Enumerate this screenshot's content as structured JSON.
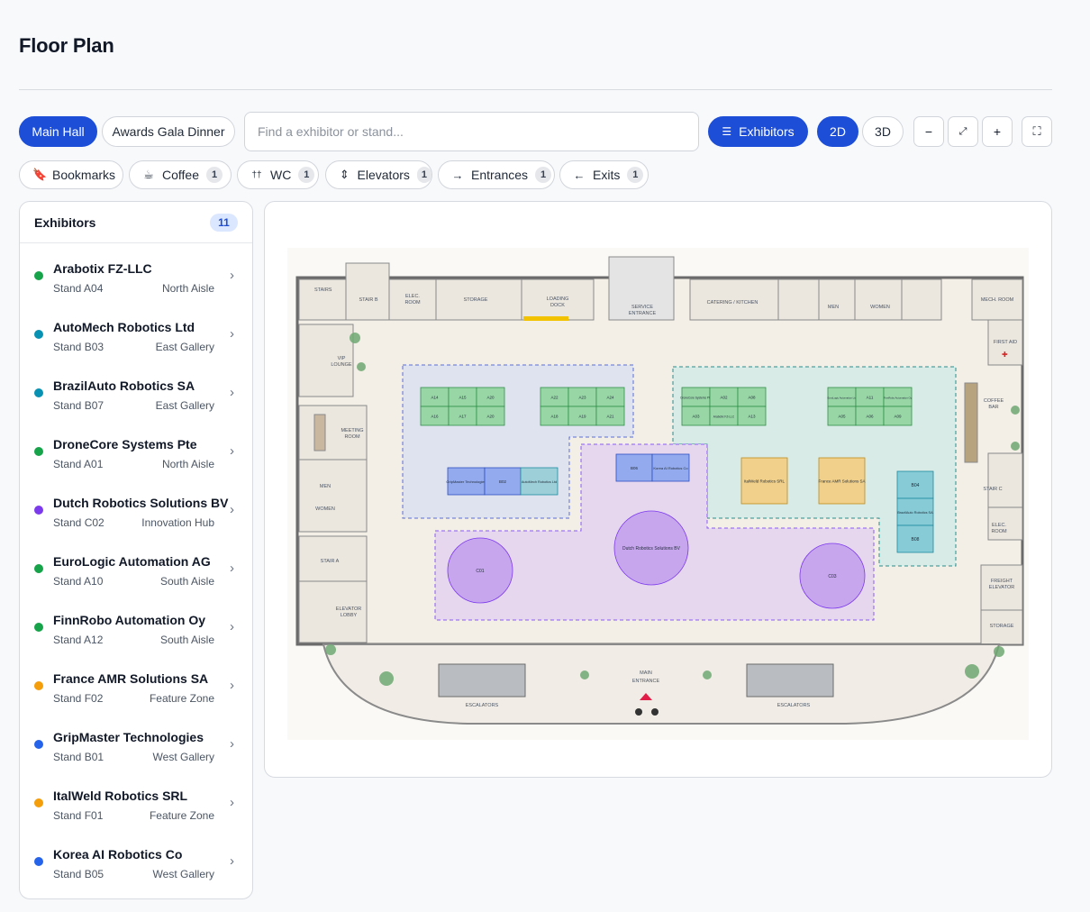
{
  "page": {
    "title": "Floor Plan"
  },
  "toolbar": {
    "tabs": [
      {
        "label": "Main Hall"
      },
      {
        "label": "Awards Gala Dinner"
      }
    ],
    "search_placeholder": "Find a exhibitor or stand...",
    "exhibitors_label": "Exhibitors",
    "view_2d": "2D",
    "view_3d": "3D",
    "zoom_out": "−",
    "zoom_reset": "⤢",
    "zoom_in": "+",
    "fullscreen": "⛶"
  },
  "filters": [
    {
      "label": "Bookmarks",
      "icon": "bookmark-icon",
      "glyph": "🔖",
      "count": ""
    },
    {
      "label": "Coffee",
      "icon": "coffee-icon",
      "glyph": "☕",
      "count": "1"
    },
    {
      "label": "WC",
      "icon": "wc-icon",
      "glyph": "††",
      "count": "1"
    },
    {
      "label": "Elevators",
      "icon": "elevator-icon",
      "glyph": "⇕",
      "count": "1"
    },
    {
      "label": "Entrances",
      "icon": "entrance-icon",
      "glyph": "→",
      "count": "1"
    },
    {
      "label": "Exits",
      "icon": "exit-icon",
      "glyph": "←",
      "count": "1"
    }
  ],
  "sidebar": {
    "title": "Exhibitors",
    "count": "11",
    "items": [
      {
        "name": "Arabotix FZ-LLC",
        "stand": "Stand A04",
        "zone": "North Aisle",
        "color": "#16a34a"
      },
      {
        "name": "AutoMech Robotics Ltd",
        "stand": "Stand B03",
        "zone": "East Gallery",
        "color": "#0891b2"
      },
      {
        "name": "BrazilAuto Robotics SA",
        "stand": "Stand B07",
        "zone": "East Gallery",
        "color": "#0891b2"
      },
      {
        "name": "DroneCore Systems Pte",
        "stand": "Stand A01",
        "zone": "North Aisle",
        "color": "#16a34a"
      },
      {
        "name": "Dutch Robotics Solutions BV",
        "stand": "Stand C02",
        "zone": "Innovation Hub",
        "color": "#7c3aed"
      },
      {
        "name": "EuroLogic Automation AG",
        "stand": "Stand A10",
        "zone": "South Aisle",
        "color": "#16a34a"
      },
      {
        "name": "FinnRobo Automation Oy",
        "stand": "Stand A12",
        "zone": "South Aisle",
        "color": "#16a34a"
      },
      {
        "name": "France AMR Solutions SA",
        "stand": "Stand F02",
        "zone": "Feature Zone",
        "color": "#f59e0b"
      },
      {
        "name": "GripMaster Technologies",
        "stand": "Stand B01",
        "zone": "West Gallery",
        "color": "#2563eb"
      },
      {
        "name": "ItalWeld Robotics SRL",
        "stand": "Stand F01",
        "zone": "Feature Zone",
        "color": "#f59e0b"
      },
      {
        "name": "Korea AI Robotics Co",
        "stand": "Stand B05",
        "zone": "West Gallery",
        "color": "#2563eb"
      }
    ]
  },
  "map": {
    "rooms": {
      "stairs": "STAIRS",
      "stair_b": "STAIR B",
      "elec_room": "ELEC.",
      "elec_room2": "ROOM",
      "storage": "STORAGE",
      "loading": "LOADING",
      "dock": "DOCK",
      "service": "SERVICE",
      "entrance": "ENTRANCE",
      "catering": "CATERING / KITCHEN",
      "men": "MEN",
      "women": "WOMEN",
      "mech_room": "MECH. ROOM",
      "first_aid": "FIRST AID",
      "vip": "VIP",
      "lounge": "LOUNGE",
      "coffee": "COFFEE",
      "bar": "BAR",
      "meeting": "MEETING",
      "room": "ROOM",
      "stair_c": "STAIR C",
      "stair_a": "STAIR A",
      "elevator": "ELEVATOR",
      "lobby": "LOBBY",
      "freight": "FREIGHT",
      "freight2": "ELEVATOR",
      "storage2": "STORAGE",
      "main": "MAIN",
      "main_entrance": "ENTRANCE",
      "escalators": "ESCALATORS"
    },
    "stands_a_left": [
      "A14",
      "A15",
      "A20",
      "A16",
      "A17",
      "A20",
      "A22",
      "A23",
      "A24",
      "A18",
      "A19",
      "A21"
    ],
    "stands_a_right": [
      "A03",
      "A13",
      "A11",
      "A05",
      "A06",
      "A09"
    ],
    "stands_named": {
      "a01": "DroneCore Systems Pte",
      "a02": "A02",
      "a08": "A08",
      "a04": "Arabotix FZ-LLC",
      "a10": "EuroLogic Automation Ltd",
      "a12": "FinnRobo Automation Oy",
      "b01": "GripMaster Technologies",
      "b02": "B02",
      "b03": "AutoMech Robotics Ltd",
      "b06": "B06",
      "b05": "Korea AI Robotics Co",
      "f01": "ItalWeld Robotics SRL",
      "f02": "France AMR Solutions SA",
      "b04": "B04",
      "b07": "BrazilAuto Robotics SA",
      "b08": "B08",
      "c01": "C01",
      "c02": "Dutch Robotics Solutions BV",
      "c03": "C03"
    }
  }
}
